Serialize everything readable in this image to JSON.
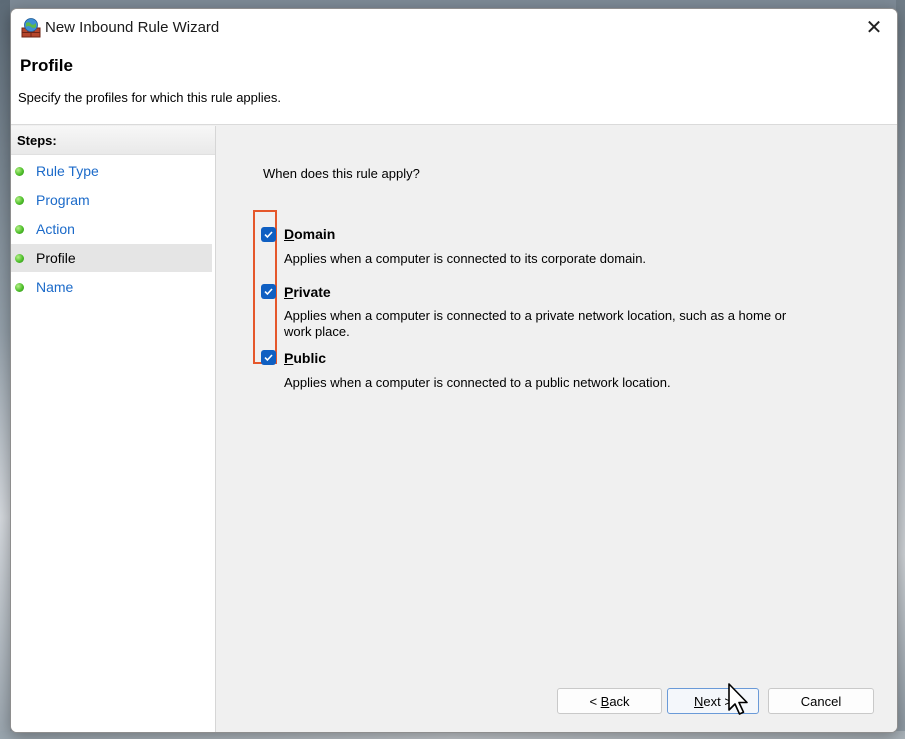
{
  "window": {
    "title": "New Inbound Rule Wizard",
    "close_symbol": "✕"
  },
  "header": {
    "title": "Profile",
    "subtitle": "Specify the profiles for which this rule applies."
  },
  "steps": {
    "heading": "Steps:",
    "items": [
      {
        "label": "Rule Type",
        "active": false
      },
      {
        "label": "Program",
        "active": false
      },
      {
        "label": "Action",
        "active": false
      },
      {
        "label": "Profile",
        "active": true
      },
      {
        "label": "Name",
        "active": false
      }
    ]
  },
  "content": {
    "question": "When does this rule apply?",
    "options": [
      {
        "label_access": "D",
        "label_rest": "omain",
        "checked": true,
        "description": "Applies when a computer is connected to its corporate domain."
      },
      {
        "label_access": "P",
        "label_rest": "rivate",
        "checked": true,
        "description": "Applies when a computer is connected to a private network location, such as a home or work place."
      },
      {
        "label_access": "P",
        "label_rest": "ublic",
        "checked": true,
        "description": "Applies when a computer is connected to a public network location."
      }
    ]
  },
  "buttons": {
    "back_prefix": "< ",
    "back_access": "B",
    "back_rest": "ack",
    "next_access": "N",
    "next_rest": "ext >",
    "cancel": "Cancel"
  },
  "colors": {
    "checkbox": "#0f5fc2",
    "highlight": "#e5572b",
    "step_link": "#1b6ac9"
  }
}
